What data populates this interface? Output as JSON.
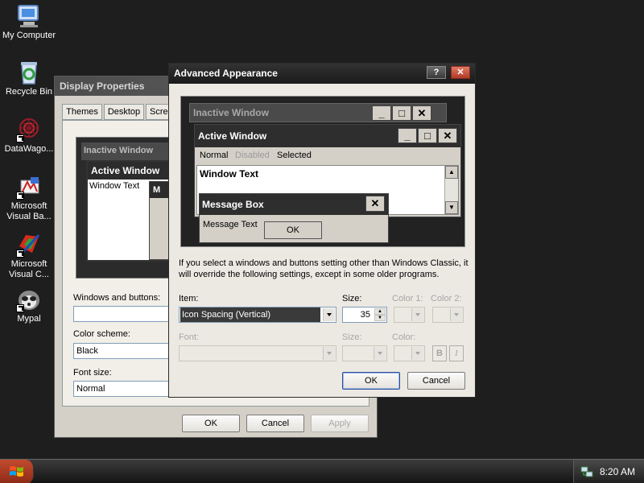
{
  "desktop": {
    "icons": [
      {
        "label": "My Computer",
        "icon": "computer-icon"
      },
      {
        "label": "Recycle Bin",
        "icon": "recycle-bin-icon"
      },
      {
        "label": "DataWago...",
        "icon": "datawagon-icon"
      },
      {
        "label": "Microsoft Visual Ba...",
        "icon": "visual-basic-icon"
      },
      {
        "label": "Microsoft Visual C...",
        "icon": "visual-c-icon"
      },
      {
        "label": "Mypal",
        "icon": "mypal-icon"
      }
    ]
  },
  "display_properties": {
    "title": "Display Properties",
    "tabs": [
      "Themes",
      "Desktop",
      "Scre"
    ],
    "preview": {
      "inactive_title": "Inactive Window",
      "active_title": "Active Window",
      "window_text": "Window Text",
      "message_title_partial": "M"
    },
    "windows_buttons_label": "Windows and buttons:",
    "windows_buttons_value": "",
    "color_scheme_label": "Color scheme:",
    "color_scheme_value": "Black",
    "font_size_label": "Font size:",
    "font_size_value": "Normal",
    "ok": "OK",
    "cancel": "Cancel",
    "apply": "Apply"
  },
  "advanced": {
    "title": "Advanced Appearance",
    "help_glyph": "?",
    "close_glyph": "✕",
    "preview": {
      "inactive_title": "Inactive Window",
      "active_title": "Active Window",
      "menu_normal": "Normal",
      "menu_disabled": "Disabled",
      "menu_selected": "Selected",
      "window_text": "Window Text",
      "msgbox_title": "Message Box",
      "msgbox_text": "Message Text",
      "msgbox_ok": "OK"
    },
    "info_text": "If you select a windows and buttons setting other than Windows Classic, it will override the following settings, except in some older programs.",
    "item_label": "Item:",
    "item_value": "Icon Spacing (Vertical)",
    "size_label": "Size:",
    "size_value": "35",
    "color1_label": "Color 1:",
    "color2_label": "Color 2:",
    "font_label": "Font:",
    "font_size_label": "Size:",
    "font_color_label": "Color:",
    "bold_glyph": "B",
    "italic_glyph": "I",
    "ok": "OK",
    "cancel": "Cancel"
  },
  "taskbar": {
    "clock": "8:20 AM"
  },
  "colors": {
    "desktop_bg": "#1e1e1e",
    "dialog_bg": "#d4d0c8",
    "close_red": "#c8402c",
    "selection": "#3a3a3a"
  }
}
